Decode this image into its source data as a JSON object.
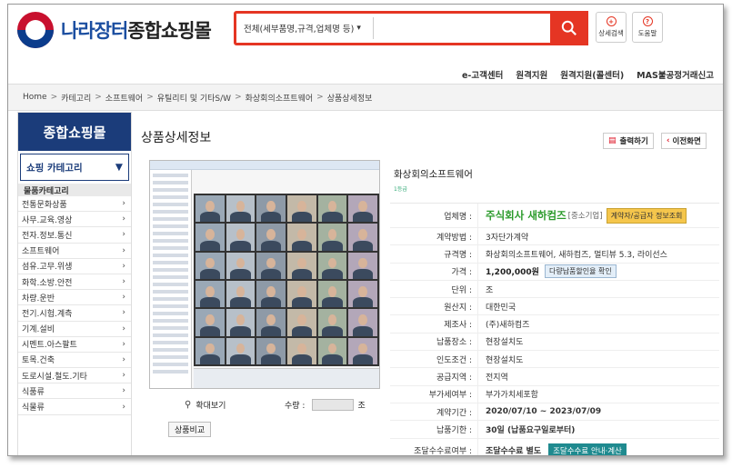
{
  "header": {
    "logo_part1": "나라장터",
    "logo_part2": "종합쇼핑몰",
    "search_category": "전체(세부품명,규격,업체명 등)",
    "search_value": "",
    "detail_search": "상세검색",
    "help": "도움말"
  },
  "topnav": [
    "e-고객센터",
    "원격지원",
    "원격지원(콜센터)",
    "MAS불공정거래신고"
  ],
  "breadcrumb": [
    "Home",
    "카테고리",
    "소프트웨어",
    "유틸리티 및 기타S/W",
    "화상회의소프트웨어",
    "상품상세정보"
  ],
  "sidebar": {
    "title": "종합쇼핑몰",
    "category_button": "쇼핑 카테고리",
    "subheader": "물품카테고리",
    "items": [
      "전통문화상품",
      "사무.교육.영상",
      "전자.정보.통신",
      "소프트웨어",
      "섬유.고무.위생",
      "화학.소방.안전",
      "차량.운반",
      "전기.시험.계측",
      "기계.설비",
      "시멘트.아스팔트",
      "토목.건축",
      "도로시설.철도.기타",
      "식품류",
      "식물류"
    ]
  },
  "main": {
    "title": "상품상세정보",
    "print": "출력하기",
    "prev": "이전화면",
    "zoom": "확대보기",
    "qty_label": "수량 :",
    "qty_value": "",
    "qty_unit": "조",
    "compare": "상품비교",
    "product_name": "화상회의소프트웨어",
    "grade_label": "1등급"
  },
  "detail": {
    "vendor_key": "업체명 :",
    "vendor_name": "주식회사 새하컴즈",
    "vendor_tag": "[중소기업]",
    "vendor_btn": "계약자/공급자 정보조회",
    "rows": [
      {
        "k": "계약방법 :",
        "v": "3자단가계약"
      },
      {
        "k": "규격명 :",
        "v": "화상회의소프트웨어, 새하컴즈, 멀티뷰 5.3, 라이선스"
      }
    ],
    "price_key": "가격 :",
    "price": "1,200,000원",
    "price_btn": "다량납품할인율 확인",
    "rows2": [
      {
        "k": "단위 :",
        "v": "조"
      },
      {
        "k": "원산지 :",
        "v": "대한민국"
      },
      {
        "k": "제조사 :",
        "v": "(주)새하컴즈"
      },
      {
        "k": "납품장소 :",
        "v": "현장설치도"
      },
      {
        "k": "인도조건 :",
        "v": "현장설치도"
      }
    ],
    "region_key": "공급지역 :",
    "region": "전지역",
    "vat_key": "부가세여부 :",
    "vat": "부가가치세포함",
    "period_key": "계약기간 :",
    "period": "2020/07/10 ~ 2023/07/09",
    "deadline_key": "납품기한 :",
    "deadline": "30일 (납품요구일로부터)",
    "fee_key": "조달수수료여부 :",
    "fee": "조달수수료 별도",
    "fee_btn": "조달수수료 안내·계산"
  }
}
